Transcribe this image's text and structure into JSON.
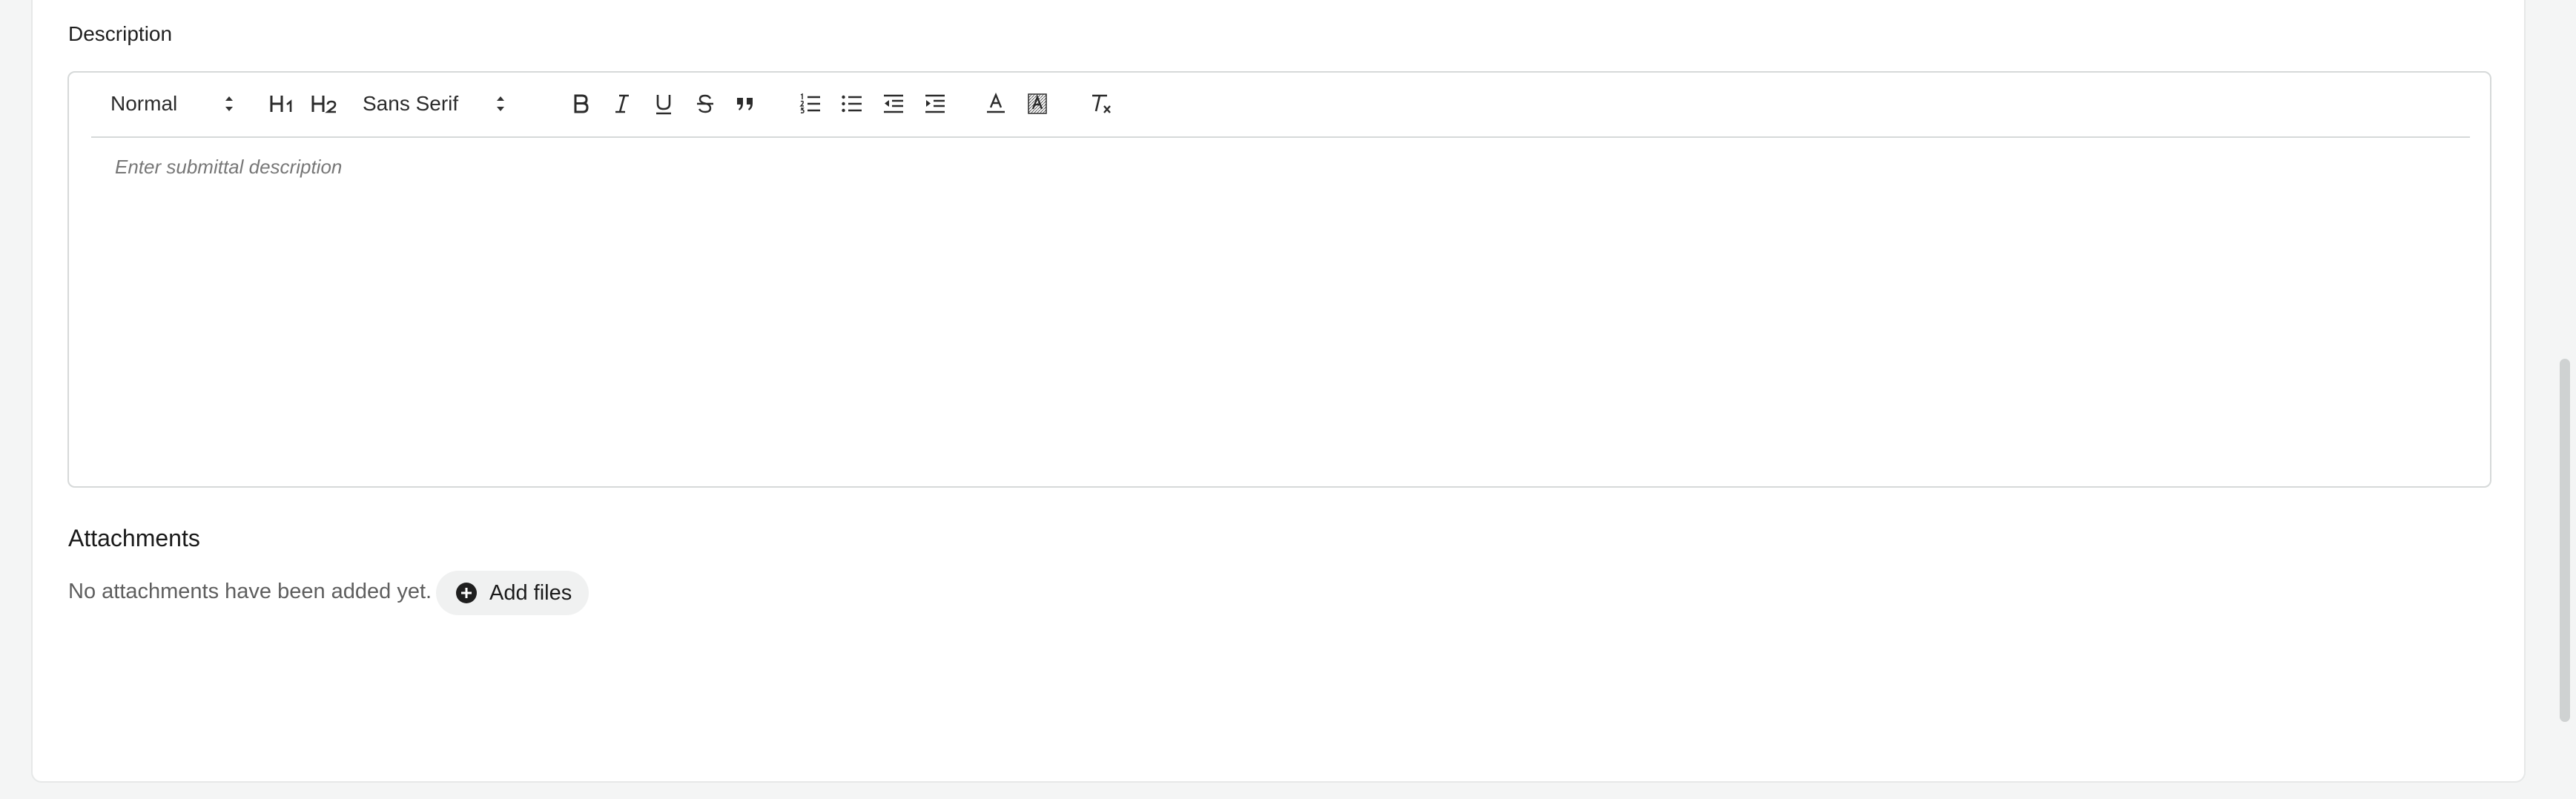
{
  "description": {
    "label": "Description",
    "placeholder": "Enter submittal description"
  },
  "toolbar": {
    "header_picker": "Normal",
    "font_picker": "Sans Serif",
    "h1_label": "H1",
    "h2_label": "H2"
  },
  "attachments": {
    "title": "Attachments",
    "empty_text": "No attachments have been added yet.",
    "add_label": "Add files"
  },
  "icons": [
    "chevron-updown-icon",
    "bold-icon",
    "italic-icon",
    "underline-icon",
    "strike-icon",
    "blockquote-icon",
    "ordered-list-icon",
    "bullet-list-icon",
    "outdent-icon",
    "indent-icon",
    "text-color-icon",
    "background-color-icon",
    "clear-format-icon",
    "plus-circle-icon"
  ]
}
